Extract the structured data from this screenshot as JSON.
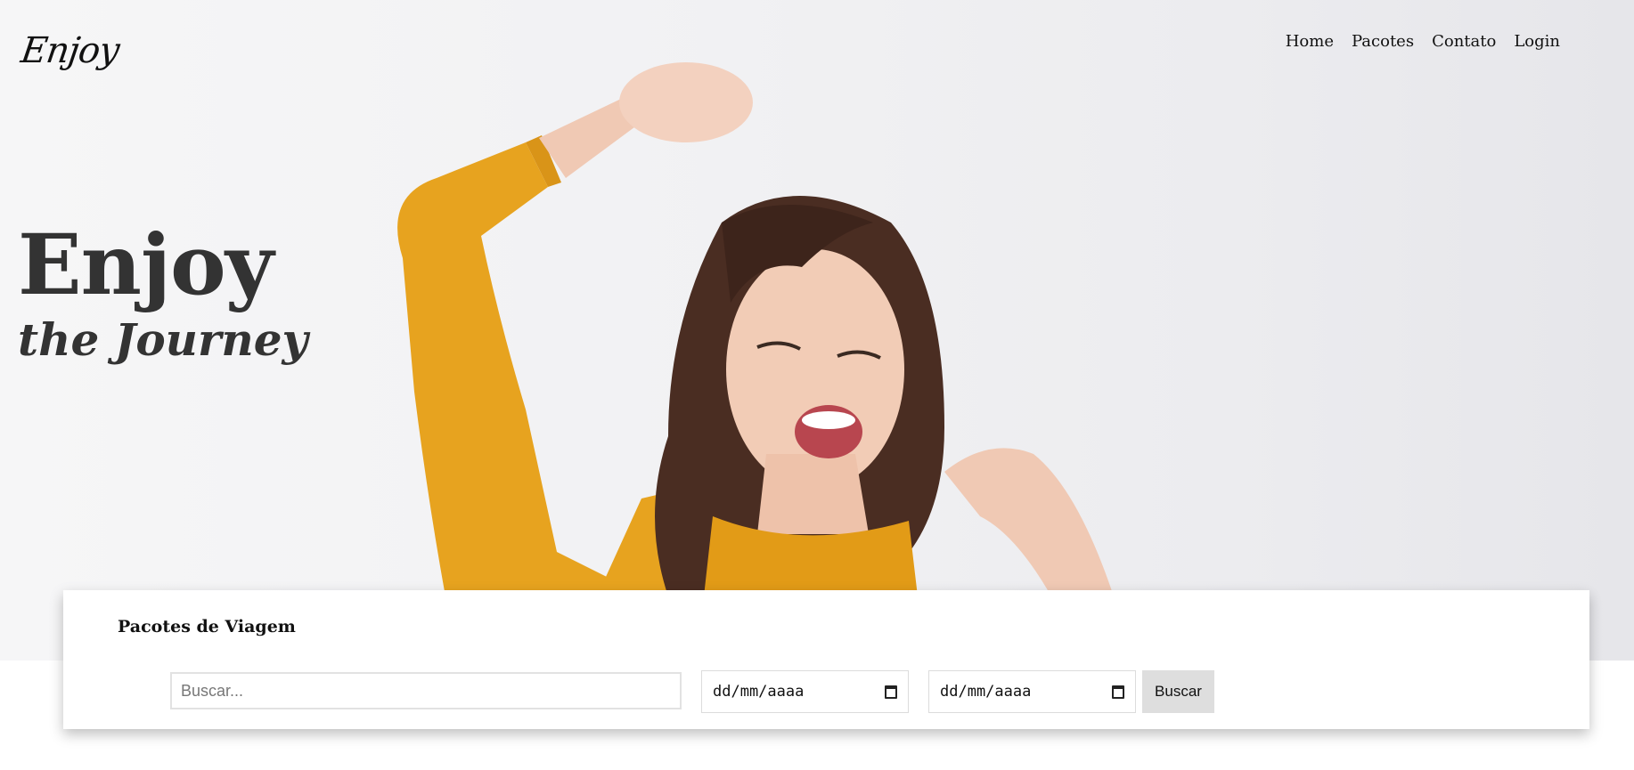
{
  "header": {
    "logo_text": "Enjoy",
    "nav": [
      "Home",
      "Pacotes",
      "Contato",
      "Login"
    ]
  },
  "hero": {
    "title": "Enjoy",
    "subtitle": "the Journey",
    "image_description_icon": "woman-dancing-photo",
    "accent_color": "#e7a31f"
  },
  "search_card": {
    "title": "Pacotes de Viagem",
    "search_placeholder": "Buscar...",
    "date_start_placeholder": "dd/mm/aaaa",
    "date_end_placeholder": "dd/mm/aaaa",
    "calendar_icon": "calendar-icon",
    "button_label": "Buscar"
  }
}
